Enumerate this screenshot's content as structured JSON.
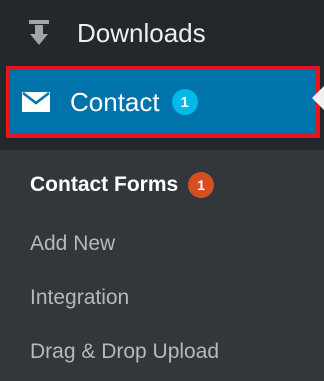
{
  "menu": {
    "downloads": {
      "label": "Downloads",
      "icon": "download-icon"
    },
    "contact": {
      "label": "Contact",
      "badge": "1",
      "icon": "envelope-icon",
      "active": true
    }
  },
  "submenu": {
    "items": [
      {
        "label": "Contact Forms",
        "badge": "1",
        "current": true
      },
      {
        "label": "Add New"
      },
      {
        "label": "Integration"
      },
      {
        "label": "Drag & Drop Upload"
      }
    ]
  },
  "colors": {
    "sidebar_bg": "#23282d",
    "submenu_bg": "#32373c",
    "active_bg": "#0073aa",
    "highlight_border": "#e8141c",
    "badge_blue": "#00b9eb",
    "badge_orange": "#d54e21"
  }
}
